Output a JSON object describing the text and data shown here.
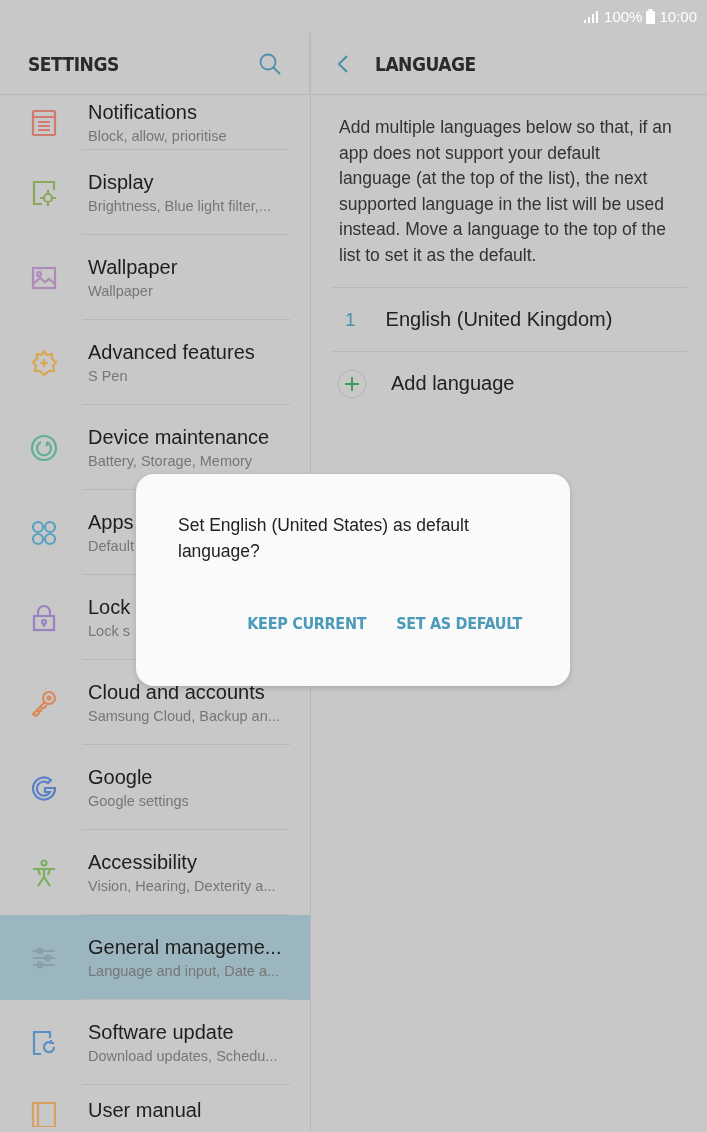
{
  "status_bar": {
    "battery": "100%",
    "time": "10:00"
  },
  "settings_header": {
    "title": "SETTINGS"
  },
  "language_header": {
    "title": "LANGUAGE"
  },
  "sidebar": {
    "items": [
      {
        "title": "Notifications",
        "subtitle": "Block, allow, prioritise",
        "color": "#d07a70",
        "selected": false
      },
      {
        "title": "Display",
        "subtitle": "Brightness, Blue light filter,...",
        "color": "#8aa860",
        "selected": false
      },
      {
        "title": "Wallpaper",
        "subtitle": "Wallpaper",
        "color": "#b08ab8",
        "selected": false
      },
      {
        "title": "Advanced features",
        "subtitle": "S Pen",
        "color": "#d8a850",
        "selected": false
      },
      {
        "title": "Device maintenance",
        "subtitle": "Battery, Storage, Memory",
        "color": "#5fae98",
        "selected": false
      },
      {
        "title": "Apps",
        "subtitle": "Default",
        "color": "#5aa0c0",
        "selected": false
      },
      {
        "title": "Lock",
        "subtitle": "Lock s",
        "color": "#9a82c0",
        "selected": false
      },
      {
        "title": "Cloud and accounts",
        "subtitle": "Samsung Cloud, Backup an...",
        "color": "#d88a58",
        "selected": false
      },
      {
        "title": "Google",
        "subtitle": "Google settings",
        "color": "#5a80c8",
        "selected": false
      },
      {
        "title": "Accessibility",
        "subtitle": "Vision, Hearing, Dexterity a...",
        "color": "#7ab060",
        "selected": false
      },
      {
        "title": "General manageme...",
        "subtitle": "Language and input, Date a...",
        "color": "#8aa0a8",
        "selected": true
      },
      {
        "title": "Software update",
        "subtitle": "Download updates, Schedu...",
        "color": "#5a90c8",
        "selected": false
      },
      {
        "title": "User manual",
        "color": "#d8a060",
        "selected": false
      }
    ]
  },
  "language": {
    "description": "Add multiple languages below so that, if an app does not support your default language (at the top of the list), the next supported language in the list will be used instead. Move a language to the top of the list to set it as the default.",
    "languages": [
      {
        "number": "1",
        "name": "English (United Kingdom)"
      }
    ],
    "add_label": "Add language"
  },
  "dialog": {
    "message": "Set English (United States) as default language?",
    "buttons": [
      "KEEP CURRENT",
      "SET AS DEFAULT"
    ]
  }
}
